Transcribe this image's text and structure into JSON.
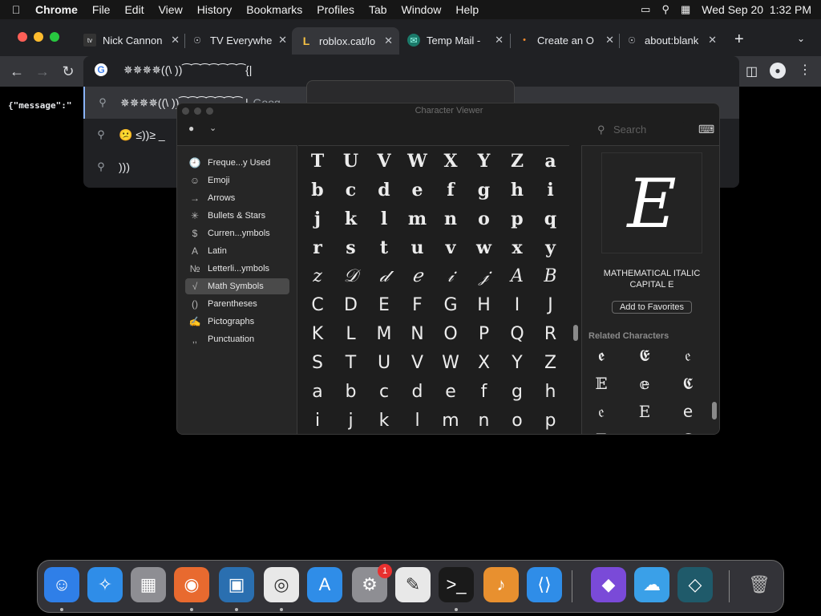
{
  "menubar": {
    "app_name": "Chrome",
    "items": [
      "File",
      "Edit",
      "View",
      "History",
      "Bookmarks",
      "Profiles",
      "Tab",
      "Window",
      "Help"
    ],
    "clock": "Wed Sep 20  1:32 PM"
  },
  "tabs": [
    {
      "label": "Nick Cannon",
      "favicon": "tv-icon"
    },
    {
      "label": "TV Everywhe",
      "favicon": "globe-icon"
    },
    {
      "label": "roblox.cat/lo",
      "favicon": "roblox-icon",
      "active": true
    },
    {
      "label": "Temp Mail -",
      "favicon": "tempmail-icon"
    },
    {
      "label": "Create an O",
      "favicon": "dot-icon"
    },
    {
      "label": "about:blank",
      "favicon": "globe-icon"
    }
  ],
  "omnibox": {
    "text": "✵✵✵✵((\\ ))⁀⁀⁀⁀⁀⁀⁀{|"
  },
  "suggestions": [
    {
      "text": "✵✵✵✵((\\ ))⁀⁀⁀⁀⁀⁀⁀ | ",
      "hint": "Goog"
    },
    {
      "text": "😕 ≤))≥ _"
    },
    {
      "text": "))) "
    }
  ],
  "page": {
    "json_text": "{\"message\":\""
  },
  "character_viewer": {
    "title": "Character Viewer",
    "search_placeholder": "Search",
    "categories": [
      {
        "label": "Freque...y Used",
        "icon": "clock-icon",
        "glyph": "🕘"
      },
      {
        "label": "Emoji",
        "icon": "smiley-icon",
        "glyph": "☺"
      },
      {
        "label": "Arrows",
        "icon": "arrow-icon",
        "glyph": "→"
      },
      {
        "label": "Bullets & Stars",
        "icon": "star-icon",
        "glyph": "✳"
      },
      {
        "label": "Curren...ymbols",
        "icon": "dollar-icon",
        "glyph": "$"
      },
      {
        "label": "Latin",
        "icon": "latin-icon",
        "glyph": "A"
      },
      {
        "label": "Letterli...ymbols",
        "icon": "numero-icon",
        "glyph": "№"
      },
      {
        "label": "Math Symbols",
        "icon": "sqrt-icon",
        "glyph": "√",
        "selected": true
      },
      {
        "label": "Parentheses",
        "icon": "parentheses-icon",
        "glyph": "()"
      },
      {
        "label": "Pictographs",
        "icon": "pictograph-icon",
        "glyph": "✍"
      },
      {
        "label": "Punctuation",
        "icon": "punctuation-icon",
        "glyph": "‚,"
      }
    ],
    "grid_rows": [
      {
        "style": "bf",
        "chars": [
          "T",
          "U",
          "V",
          "W",
          "X",
          "Y",
          "Z",
          "a"
        ]
      },
      {
        "style": "bf",
        "chars": [
          "b",
          "c",
          "d",
          "e",
          "f",
          "g",
          "h",
          "i"
        ]
      },
      {
        "style": "bf",
        "chars": [
          "j",
          "k",
          "l",
          "m",
          "n",
          "o",
          "p",
          "q"
        ]
      },
      {
        "style": "bf",
        "chars": [
          "r",
          "s",
          "t",
          "u",
          "v",
          "w",
          "x",
          "y"
        ]
      },
      {
        "style": "it",
        "chars": [
          "z",
          "𝒟",
          "𝒹",
          "ℯ",
          "𝒾",
          "𝒿",
          "A",
          "B"
        ]
      },
      {
        "style": "ss",
        "chars": [
          "C",
          "D",
          "E",
          "F",
          "G",
          "H",
          "I",
          "J"
        ]
      },
      {
        "style": "ss",
        "chars": [
          "K",
          "L",
          "M",
          "N",
          "O",
          "P",
          "Q",
          "R"
        ]
      },
      {
        "style": "ss",
        "chars": [
          "S",
          "T",
          "U",
          "V",
          "W",
          "X",
          "Y",
          "Z"
        ]
      },
      {
        "style": "ss",
        "chars": [
          "a",
          "b",
          "c",
          "d",
          "e",
          "f",
          "g",
          "h"
        ]
      },
      {
        "style": "ss",
        "chars": [
          "i",
          "j",
          "k",
          "l",
          "m",
          "n",
          "o",
          "p"
        ]
      }
    ],
    "selected_char": "E",
    "selected_name": "MATHEMATICAL ITALIC CAPITAL E",
    "add_favorites_label": "Add to Favorites",
    "related_heading": "Related Characters",
    "related_rows": [
      [
        "𝖊",
        "𝕰",
        "𝔢"
      ],
      [
        "𝔼",
        "𝕖",
        "𝕮"
      ],
      [
        "𝔢",
        "E",
        "𝖾"
      ],
      [
        "E",
        "𝔢",
        "Ɛ"
      ]
    ]
  },
  "dock": {
    "apps": [
      {
        "name": "finder-icon",
        "glyph": "☺",
        "color": "#2f7fe8"
      },
      {
        "name": "safari-icon",
        "glyph": "✧",
        "color": "#2f8de8"
      },
      {
        "name": "launchpad-icon",
        "glyph": "▦",
        "color": "#8e8e93"
      },
      {
        "name": "firefox-icon",
        "glyph": "◉",
        "color": "#e86a2f"
      },
      {
        "name": "screen-icon",
        "glyph": "▣",
        "color": "#2a6fb0"
      },
      {
        "name": "chrome-icon",
        "glyph": "◎",
        "color": "#e8e8e8"
      },
      {
        "name": "appstore-icon",
        "glyph": "A",
        "color": "#2f8de8"
      },
      {
        "name": "settings-icon",
        "glyph": "⚙",
        "color": "#8e8e93"
      },
      {
        "name": "textedit-icon",
        "glyph": "✎",
        "color": "#e8e8e8"
      },
      {
        "name": "terminal-icon",
        "glyph": ">_",
        "color": "#1a1a1a"
      },
      {
        "name": "garageband-icon",
        "glyph": "♪",
        "color": "#e8902f"
      },
      {
        "name": "vscode-icon",
        "glyph": "⟨⟩",
        "color": "#2f8de8"
      },
      {
        "name": "visualstudio-icon",
        "glyph": "◆",
        "color": "#7a4ad8"
      },
      {
        "name": "weather-icon",
        "glyph": "☁",
        "color": "#3aa0e8"
      },
      {
        "name": "cleaner-icon",
        "glyph": "◇",
        "color": "#1f5a6a"
      },
      {
        "name": "trash-icon",
        "glyph": "🗑",
        "color": "#6a6a6a"
      }
    ],
    "settings_badge": "1"
  }
}
